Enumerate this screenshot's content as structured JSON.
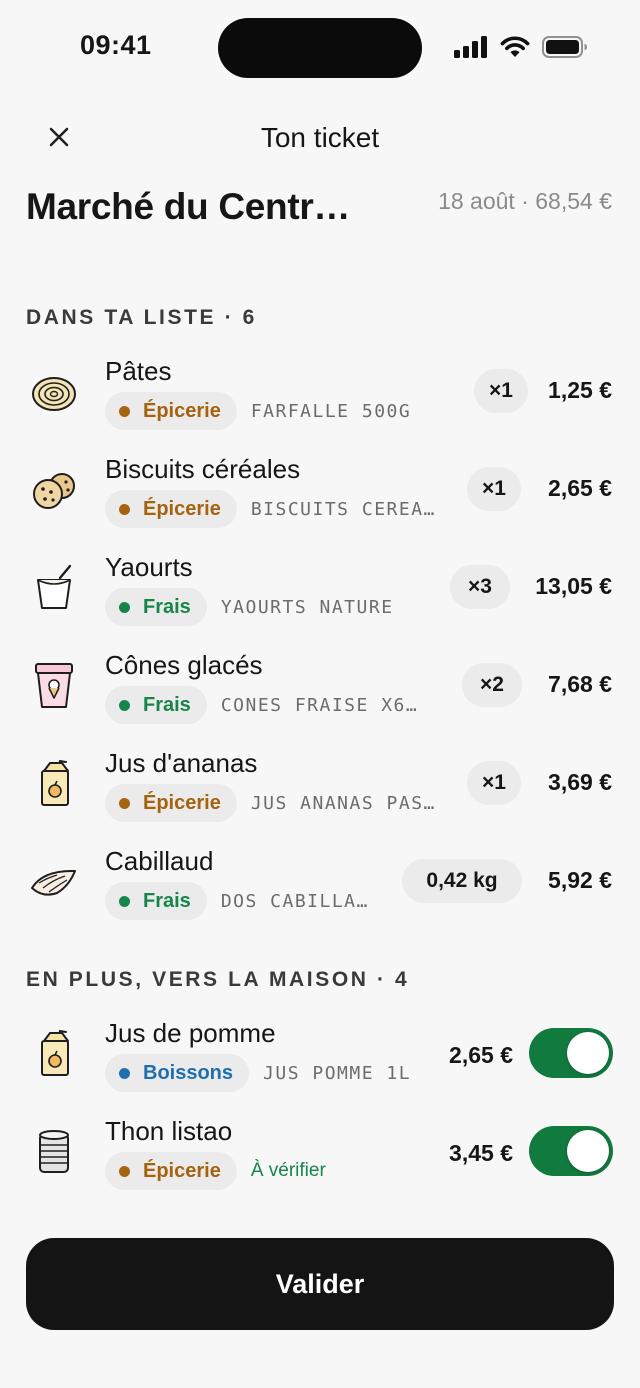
{
  "status_bar": {
    "time": "09:41",
    "icons": [
      "signal-icon",
      "wifi-icon",
      "battery-icon"
    ]
  },
  "header": {
    "title": "Ton ticket",
    "close_icon": "close-icon"
  },
  "store": {
    "name": "Marché du Centr…",
    "meta": "18 août · 68,54 €"
  },
  "in_list": {
    "label": "DANS TA LISTE · 6",
    "items": [
      {
        "name": "Pâtes",
        "category": "Épicerie",
        "code": "FARFALLE 500G",
        "qty": "×1",
        "price": "1,25 €",
        "icon": "pasta-icon"
      },
      {
        "name": "Biscuits céréales",
        "category": "Épicerie",
        "code": "BISCUITS CEREA…",
        "qty": "×1",
        "price": "2,65 €",
        "icon": "cookies-icon"
      },
      {
        "name": "Yaourts",
        "category": "Frais",
        "code": "YAOURTS NATURE",
        "qty": "×3",
        "price": "13,05 €",
        "icon": "yogurt-icon"
      },
      {
        "name": "Cônes glacés",
        "category": "Frais",
        "code": "CONES FRAISE X6…",
        "qty": "×2",
        "price": "7,68 €",
        "icon": "ice-cream-tub-icon"
      },
      {
        "name": "Jus d'ananas",
        "category": "Épicerie",
        "code": "JUS ANANAS PAS…",
        "qty": "×1",
        "price": "3,69 €",
        "icon": "juice-box-icon"
      },
      {
        "name": "Cabillaud",
        "category": "Frais",
        "code": "DOS CABILLA…",
        "qty": "0,42 kg",
        "price": "5,92 €",
        "icon": "fish-fillet-icon"
      }
    ]
  },
  "extras": {
    "label": "EN PLUS, VERS LA MAISON · 4",
    "items": [
      {
        "name": "Jus de pomme",
        "category": "Boissons",
        "code": "JUS POMME 1L",
        "price": "2,65 €",
        "toggle_on": true,
        "icon": "juice-box-icon"
      },
      {
        "name": "Thon listao",
        "category": "Épicerie",
        "note": "À vérifier",
        "price": "3,45 €",
        "toggle_on": true,
        "icon": "tin-can-icon"
      }
    ]
  },
  "colors": {
    "epicerie": "#a5620f",
    "frais": "#17854a",
    "boissons": "#1f6fb0",
    "toggle_on": "#117a3f",
    "primary_button": "#141414"
  },
  "action": {
    "validate_label": "Valider"
  }
}
